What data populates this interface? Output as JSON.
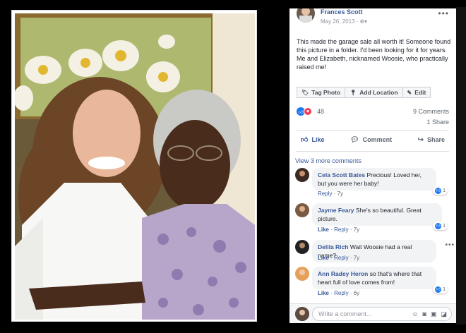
{
  "post": {
    "author": "Frances Scott",
    "date": "May 26, 2013 · ",
    "privacy_icon": "globe-icon",
    "text": "This made the garage sale all worth it! Someone found this picture in a folder. I'd been looking for it for years. Me and Elizabeth, nicknamed Woosie, who practically raised me!"
  },
  "tagbar": {
    "tag_photo": "Tag Photo",
    "add_location": "Add Location",
    "edit": "Edit"
  },
  "stats": {
    "reaction_count": "48",
    "comments": "9 Comments",
    "shares": "1 Share"
  },
  "actions": {
    "like": "Like",
    "comment": "Comment",
    "share": "Share"
  },
  "view_more": "View 3 more comments",
  "comments": [
    {
      "name": "Cela Scott Bates",
      "text": "Precious! Loved her, but you were her baby!",
      "reply": "Reply",
      "time": "7y",
      "like": "",
      "reacts": "1"
    },
    {
      "name": "Jayme Feary",
      "text": "She's so beautiful. Great picture.",
      "reply": "Reply",
      "time": "7y",
      "like": "Like",
      "reacts": "1"
    },
    {
      "name": "Delila Rich",
      "text": "Wait Woosie had a real name?",
      "reply": "Reply",
      "time": "7y",
      "like": "Like",
      "reacts": ""
    },
    {
      "name": "Ann Radey Heron",
      "text": "so that's where that heart full of love comes from!",
      "reply": "Reply",
      "time": "6y",
      "like": "Like",
      "reacts": "1"
    }
  ],
  "compose": {
    "placeholder": "Write a comment..."
  },
  "colors": {
    "link": "#385898",
    "accent": "#1877f2",
    "love": "#f33e58"
  }
}
